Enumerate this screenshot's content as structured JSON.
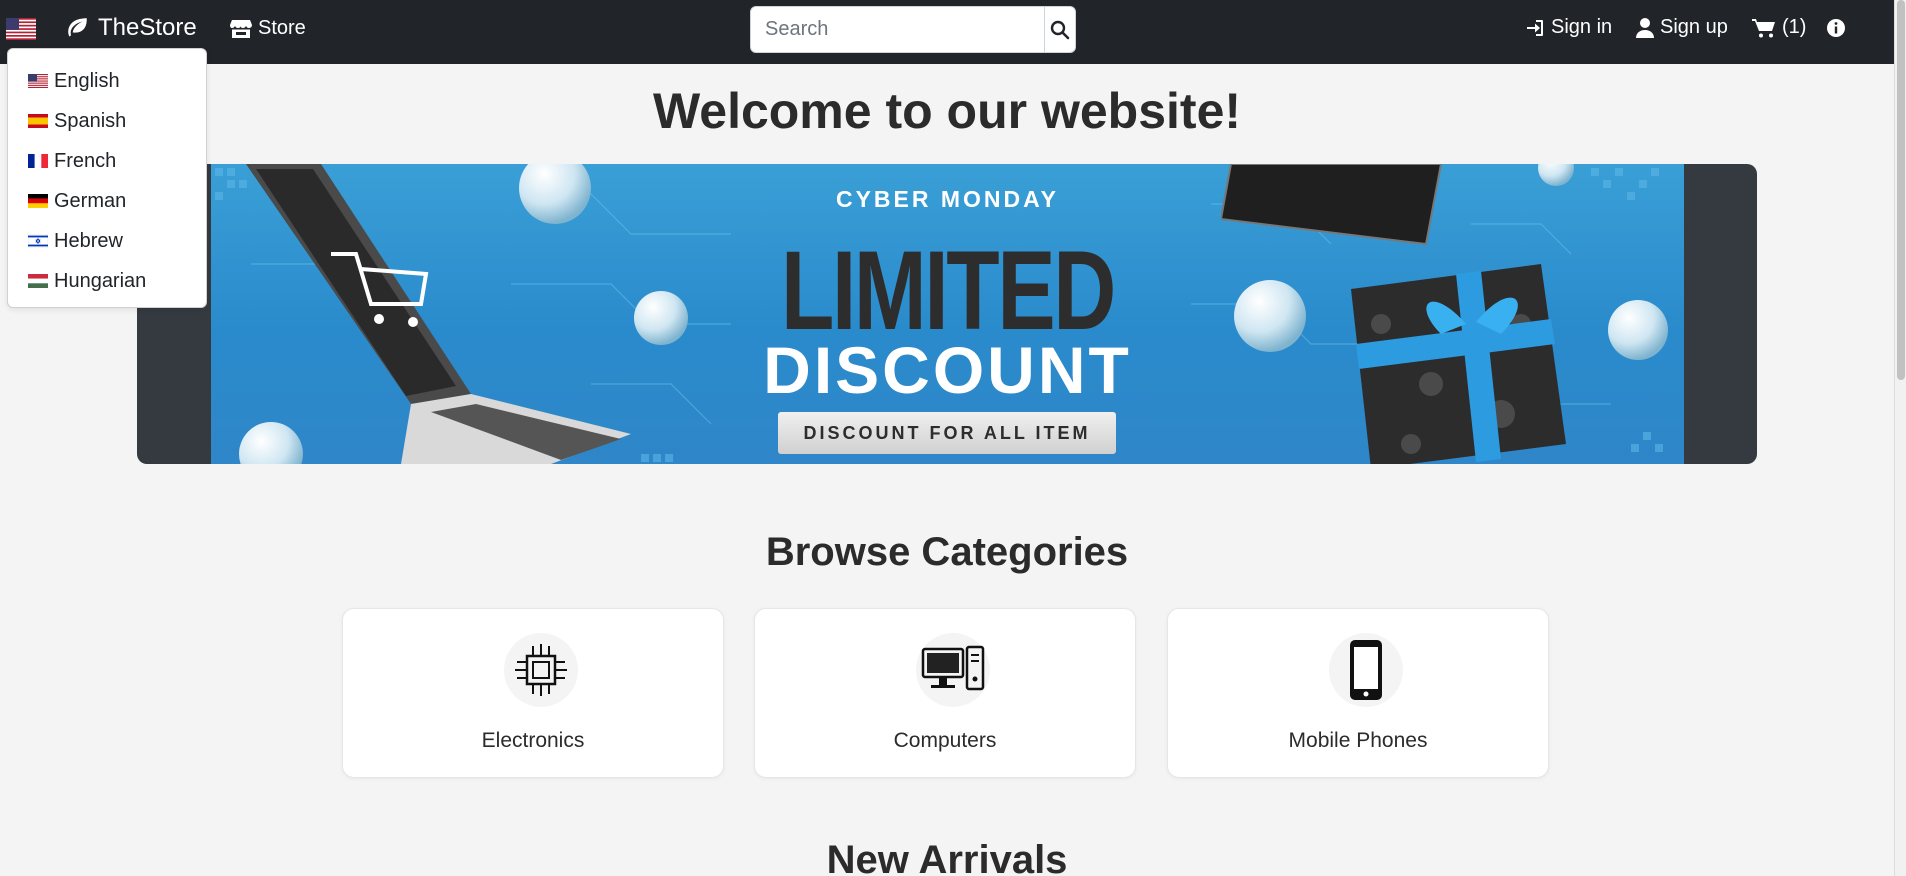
{
  "nav": {
    "brand": "TheStore",
    "store_label": "Store",
    "search_placeholder": "Search",
    "sign_in": "Sign in",
    "sign_up": "Sign up",
    "cart_count": "(1)"
  },
  "language_menu": {
    "items": [
      {
        "label": "English",
        "flag": "us-flag-icon"
      },
      {
        "label": "Spanish",
        "flag": "spain-flag-icon"
      },
      {
        "label": "French",
        "flag": "france-flag-icon"
      },
      {
        "label": "German",
        "flag": "germany-flag-icon"
      },
      {
        "label": "Hebrew",
        "flag": "israel-flag-icon"
      },
      {
        "label": "Hungarian",
        "flag": "hungary-flag-icon"
      }
    ]
  },
  "hero": {
    "welcome": "Welcome to our website!",
    "banner": {
      "kicker": "CYBER MONDAY",
      "headline": "LIMITED",
      "subheadline": "DISCOUNT",
      "tagline": "DISCOUNT FOR ALL ITEM"
    }
  },
  "categories": {
    "title": "Browse Categories",
    "items": [
      {
        "label": "Electronics",
        "icon": "chip-icon"
      },
      {
        "label": "Computers",
        "icon": "desktop-computer-icon"
      },
      {
        "label": "Mobile Phones",
        "icon": "mobile-phone-icon"
      }
    ]
  },
  "new_arrivals": {
    "title": "New Arrivals"
  },
  "colors": {
    "navbar": "#212529",
    "page_bg": "#f4f4f4",
    "banner_blue": "#2a8bcc"
  }
}
